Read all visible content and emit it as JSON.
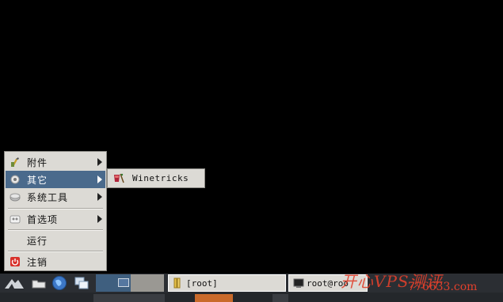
{
  "menu": {
    "items": [
      {
        "label": "附件",
        "icon": "accessories-icon",
        "submenu": true
      },
      {
        "label": "其它",
        "icon": "gear-icon",
        "submenu": true,
        "selected": true
      },
      {
        "label": "系统工具",
        "icon": "system-tools-icon",
        "submenu": true
      },
      {
        "label": "首选项",
        "icon": "preferences-icon",
        "submenu": true
      },
      {
        "label": "运行",
        "icon": "",
        "submenu": false
      },
      {
        "label": "注销",
        "icon": "power-icon",
        "submenu": false
      }
    ]
  },
  "submenu": {
    "items": [
      {
        "label": "Winetricks",
        "icon": "winetricks-icon"
      }
    ]
  },
  "taskbar": {
    "launchers": [
      "start-menu-icon",
      "file-manager-icon",
      "web-browser-icon",
      "show-desktop-icon"
    ],
    "tasks": [
      {
        "label": "[root]",
        "icon": "folder-icon"
      },
      {
        "label": "root@roo",
        "icon": "terminal-icon"
      }
    ]
  },
  "watermark": {
    "text1": "开心VPS测评",
    "text2": "776633.com"
  },
  "colors": {
    "menu_bg": "#dcdad5",
    "selection": "#4a6a8c",
    "taskbar_bg": "#2b2e33",
    "desktop": "#000000"
  }
}
